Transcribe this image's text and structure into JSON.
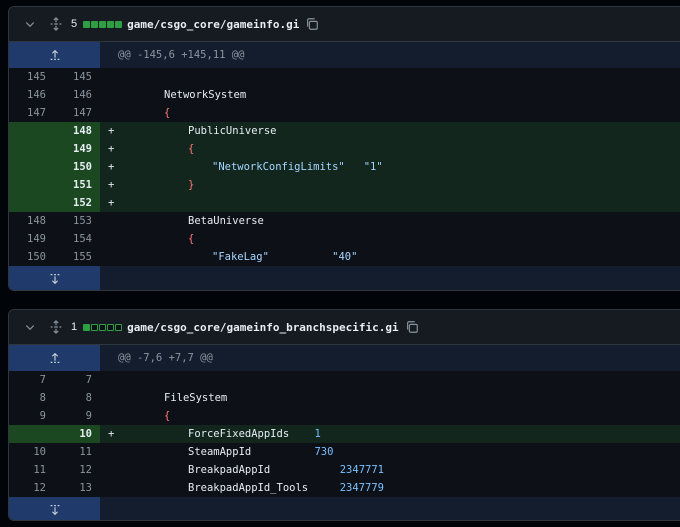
{
  "files": [
    {
      "count": "5",
      "diffstat": [
        "add",
        "add",
        "add",
        "add",
        "add"
      ],
      "path": "game/csgo_core/gameinfo.gi",
      "hunk": "@@ -145,6 +145,11 @@",
      "lines": [
        {
          "old": "145",
          "new": "145",
          "m": "",
          "type": "ctx",
          "parts": []
        },
        {
          "old": "146",
          "new": "146",
          "m": "",
          "type": "ctx",
          "indent": 1,
          "parts": [
            {
              "t": "NetworkSystem"
            }
          ]
        },
        {
          "old": "147",
          "new": "147",
          "m": "",
          "type": "ctx",
          "indent": 1,
          "parts": [
            {
              "t": "{",
              "c": "kw"
            }
          ]
        },
        {
          "old": "",
          "new": "148",
          "m": "+",
          "type": "add",
          "indent": 2,
          "parts": [
            {
              "t": "PublicUniverse"
            }
          ]
        },
        {
          "old": "",
          "new": "149",
          "m": "+",
          "type": "add",
          "indent": 2,
          "parts": [
            {
              "t": "{",
              "c": "kw"
            }
          ]
        },
        {
          "old": "",
          "new": "150",
          "m": "+",
          "type": "add",
          "indent": 3,
          "parts": [
            {
              "t": "\"NetworkConfigLimits\"",
              "c": "str"
            },
            {
              "t": "   "
            },
            {
              "t": "\"1\"",
              "c": "str"
            }
          ]
        },
        {
          "old": "",
          "new": "151",
          "m": "+",
          "type": "add",
          "indent": 2,
          "parts": [
            {
              "t": "}",
              "c": "kw"
            }
          ]
        },
        {
          "old": "",
          "new": "152",
          "m": "+",
          "type": "add",
          "parts": []
        },
        {
          "old": "148",
          "new": "153",
          "m": "",
          "type": "ctx",
          "indent": 2,
          "parts": [
            {
              "t": "BetaUniverse"
            }
          ]
        },
        {
          "old": "149",
          "new": "154",
          "m": "",
          "type": "ctx",
          "indent": 2,
          "parts": [
            {
              "t": "{",
              "c": "kw"
            }
          ]
        },
        {
          "old": "150",
          "new": "155",
          "m": "",
          "type": "ctx",
          "indent": 3,
          "parts": [
            {
              "t": "\"FakeLag\"",
              "c": "str"
            },
            {
              "t": "          "
            },
            {
              "t": "\"40\"",
              "c": "str"
            }
          ]
        }
      ]
    },
    {
      "count": "1",
      "diffstat": [
        "add",
        "neutral",
        "neutral",
        "neutral",
        "neutral"
      ],
      "path": "game/csgo_core/gameinfo_branchspecific.gi",
      "hunk": "@@ -7,6 +7,7 @@",
      "lines": [
        {
          "old": "7",
          "new": "7",
          "m": "",
          "type": "ctx",
          "parts": []
        },
        {
          "old": "8",
          "new": "8",
          "m": "",
          "type": "ctx",
          "indent": 1,
          "parts": [
            {
              "t": "FileSystem"
            }
          ]
        },
        {
          "old": "9",
          "new": "9",
          "m": "",
          "type": "ctx",
          "indent": 1,
          "parts": [
            {
              "t": "{",
              "c": "kw"
            }
          ]
        },
        {
          "old": "",
          "new": "10",
          "m": "+",
          "type": "add",
          "indent": 2,
          "parts": [
            {
              "t": "ForceFixedAppIds"
            },
            {
              "t": "    "
            },
            {
              "t": "1",
              "c": "num"
            }
          ]
        },
        {
          "old": "10",
          "new": "11",
          "m": "",
          "type": "ctx",
          "indent": 2,
          "parts": [
            {
              "t": "SteamAppId"
            },
            {
              "t": "          "
            },
            {
              "t": "730",
              "c": "num"
            }
          ]
        },
        {
          "old": "11",
          "new": "12",
          "m": "",
          "type": "ctx",
          "indent": 2,
          "parts": [
            {
              "t": "BreakpadAppId"
            },
            {
              "t": "           "
            },
            {
              "t": "2347771",
              "c": "num"
            }
          ]
        },
        {
          "old": "12",
          "new": "13",
          "m": "",
          "type": "ctx",
          "indent": 2,
          "parts": [
            {
              "t": "BreakpadAppId_Tools"
            },
            {
              "t": "     "
            },
            {
              "t": "2347779",
              "c": "num"
            }
          ]
        }
      ]
    }
  ],
  "icons": {
    "collapse": "chevron-down-icon",
    "expand": "fold-icon",
    "copy": "copy-icon",
    "expand_up": "unfold-up-icon",
    "expand_down": "unfold-down-icon"
  },
  "colors": {
    "add_bg": "#12261e",
    "add_ln_bg": "#1b4721",
    "hunk_bg": "#131d2e",
    "expander_bg": "#1f3a6b",
    "keyword": "#ff7b72",
    "string": "#a5d6ff",
    "number": "#79c0ff"
  }
}
